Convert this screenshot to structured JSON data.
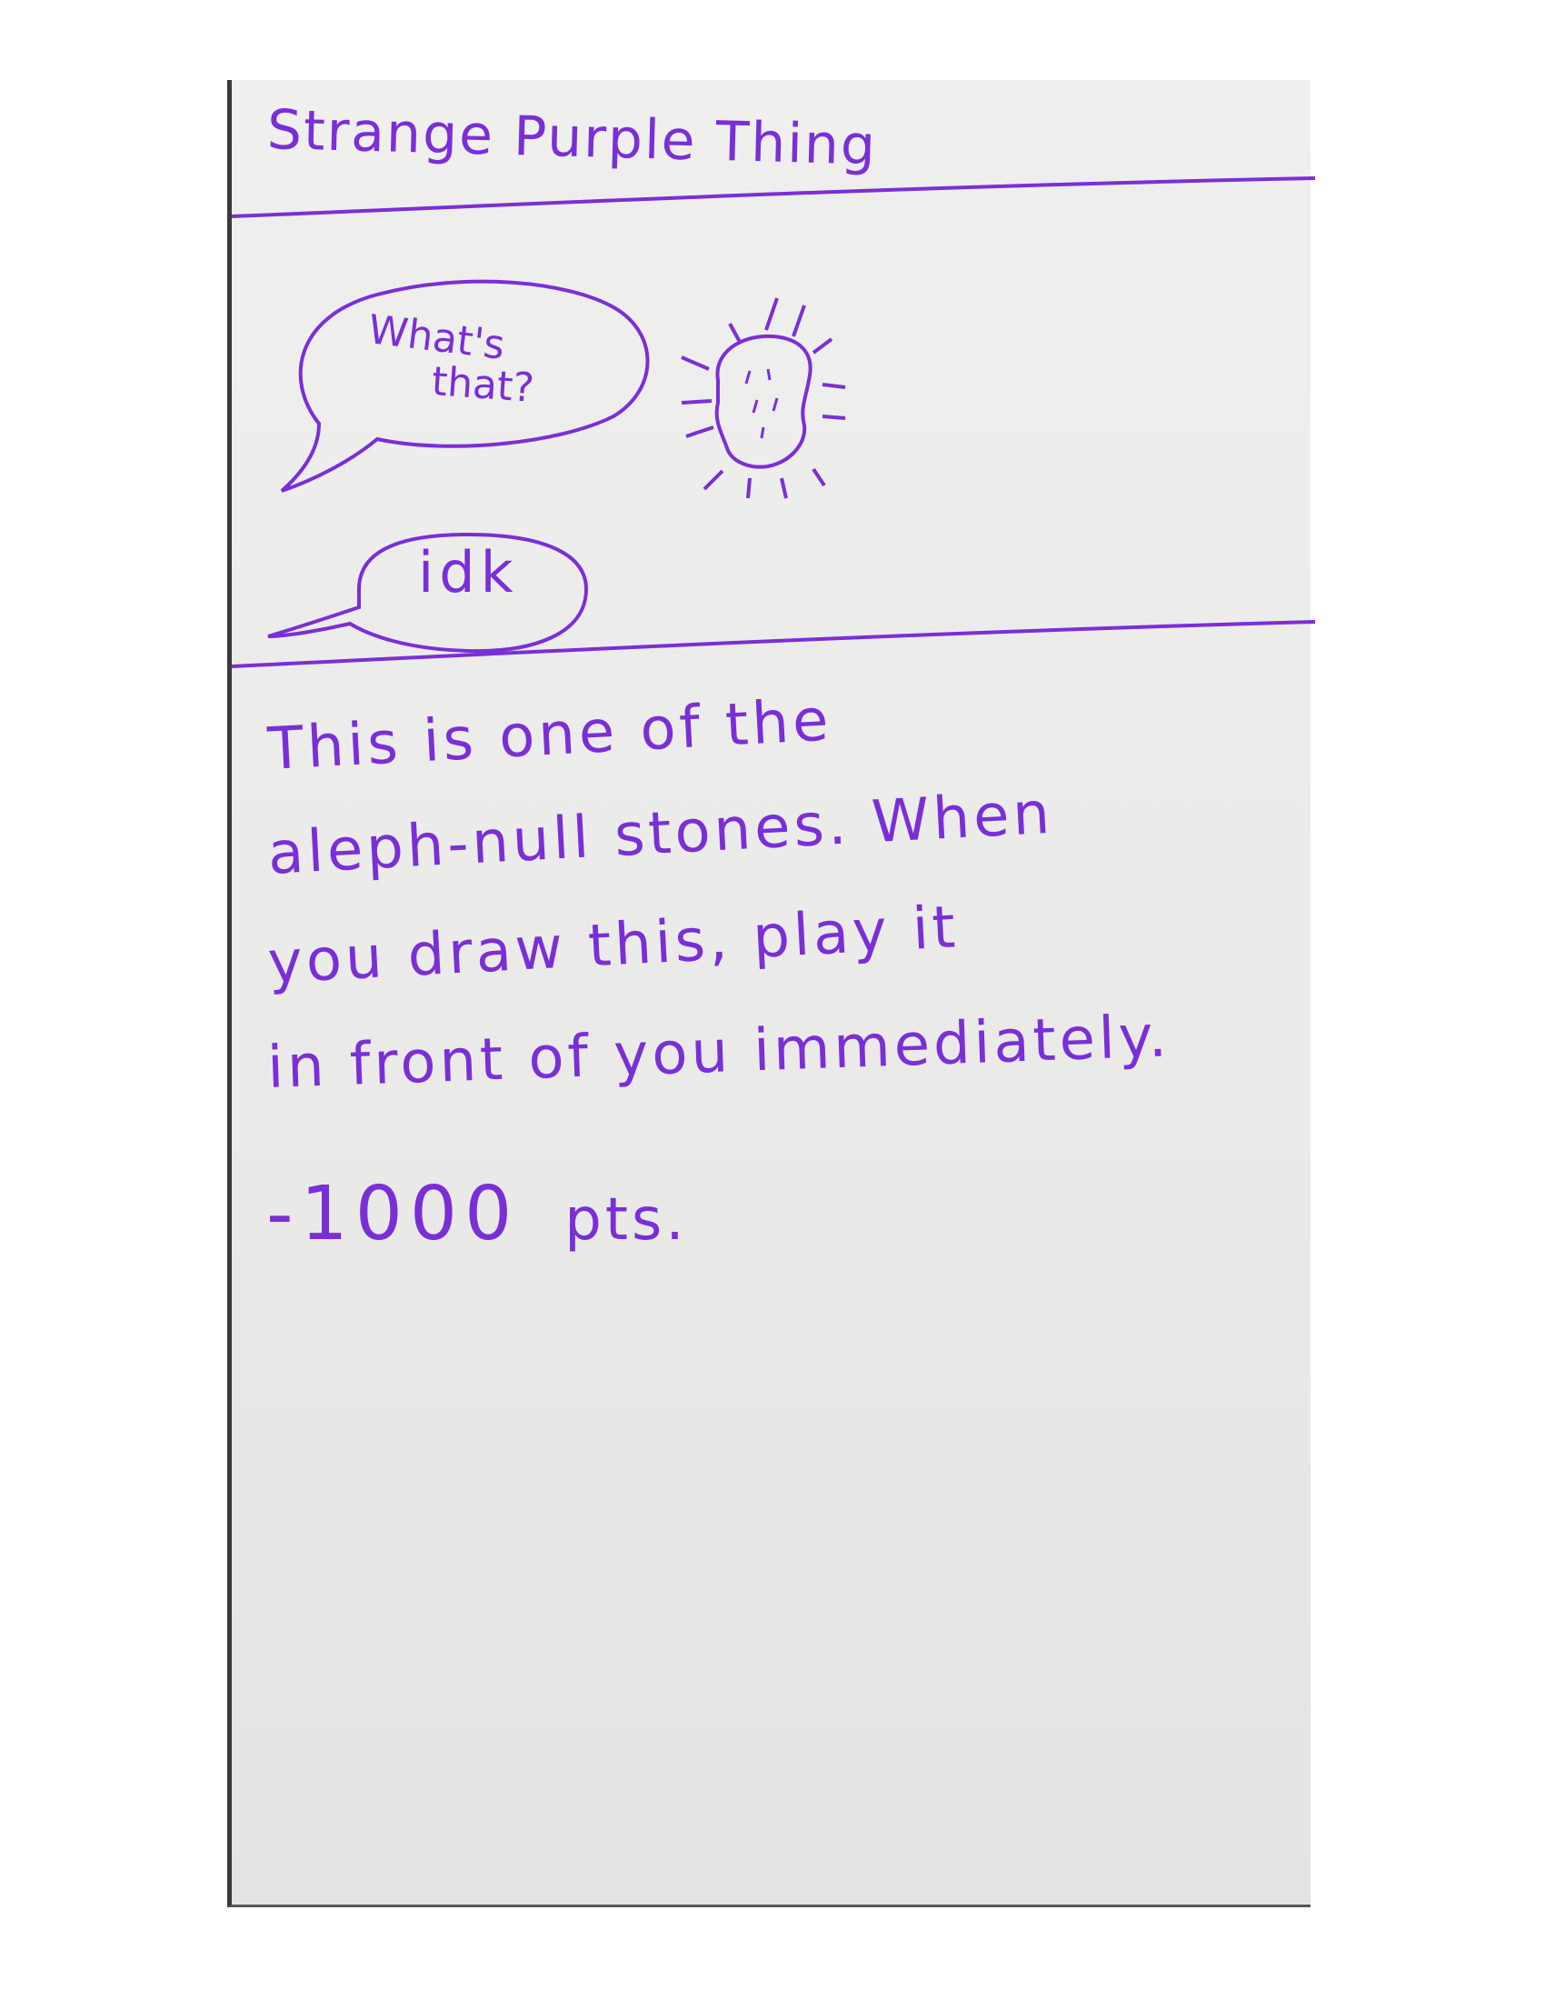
{
  "card": {
    "title": "Strange Purple Thing",
    "bubbles": {
      "first_line_1": "What's",
      "first_line_2": "that?",
      "second": "idk"
    },
    "description": {
      "line_1": "This is one of the",
      "line_2": "aleph-null stones. When",
      "line_3": "you draw this, play it",
      "line_4": "in front of you immediately."
    },
    "points": {
      "value": "-1000",
      "unit": "pts."
    }
  },
  "colors": {
    "ink": "#7a2fd6",
    "paper": "#ececea"
  },
  "icons": {
    "stone": "glowing-stone-icon"
  }
}
